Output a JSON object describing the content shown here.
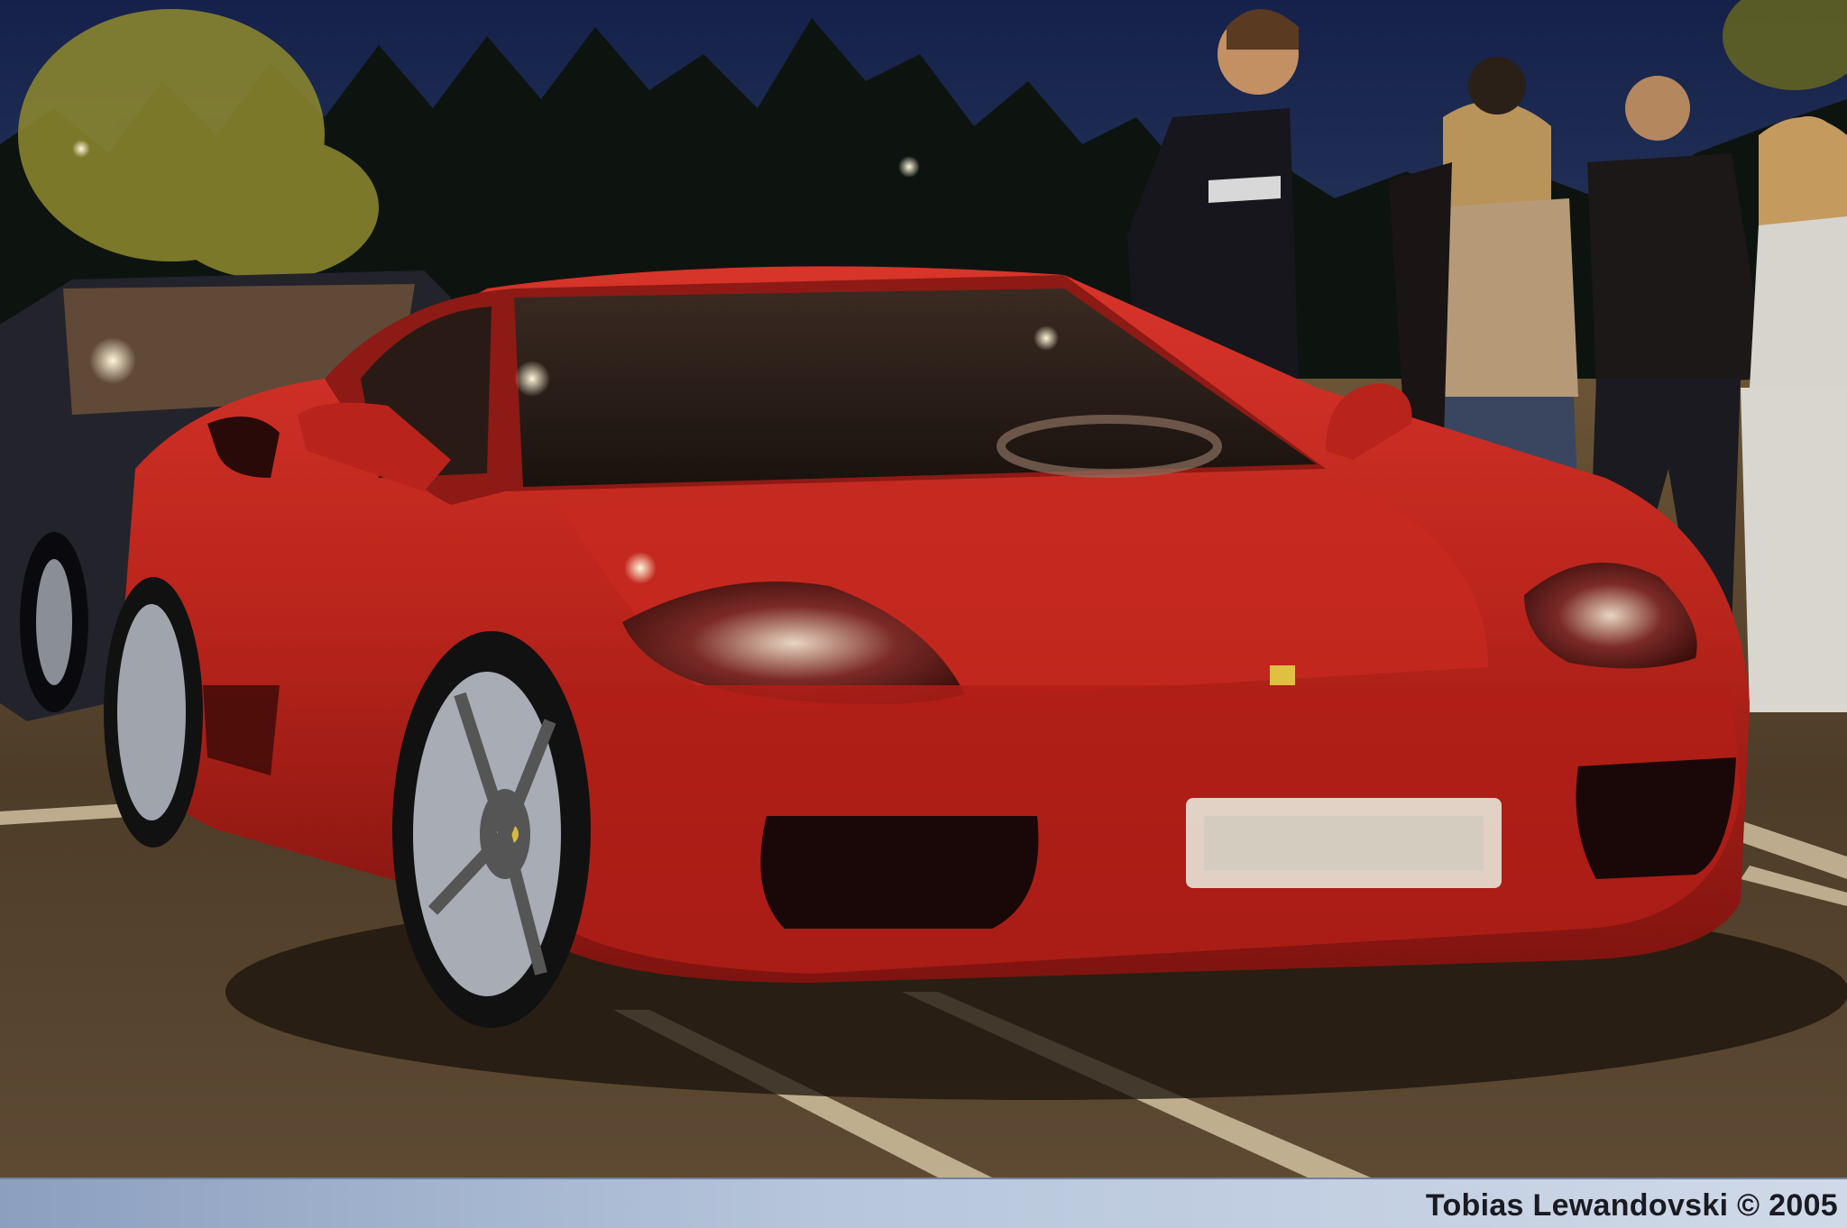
{
  "photo": {
    "subject": "red-sports-car-front",
    "scene": "parking-lot-at-dusk"
  },
  "caption": {
    "text": "Tobias Lewandovski © 2005"
  },
  "colors": {
    "car_body": "#b3241a",
    "sky": "#1c2a4e",
    "asphalt": "#4a3a2c",
    "caption_strip": "#b7c6dc",
    "caption_text": "#1a1a22"
  }
}
